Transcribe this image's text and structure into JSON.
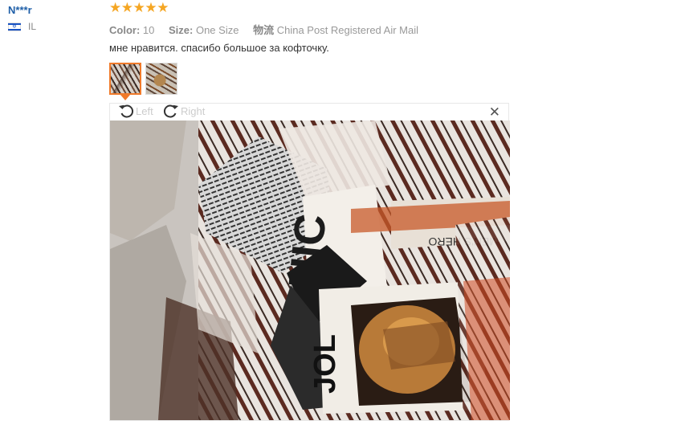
{
  "reviewer": {
    "name": "N***r",
    "country": "IL",
    "flag_icon": "israel-flag-icon"
  },
  "rating": {
    "stars": 5,
    "max": 5,
    "color": "#f5a623"
  },
  "attributes": [
    {
      "label": "Color:",
      "value": "10"
    },
    {
      "label": "Size:",
      "value": "One Size"
    },
    {
      "label": "物流",
      "value": "China Post Registered Air Mail"
    }
  ],
  "review_text": "мне нравится. спасибо большое за кофточку.",
  "thumbnails": [
    {
      "name": "photo-1",
      "active": true
    },
    {
      "name": "photo-2",
      "active": false
    }
  ],
  "viewer": {
    "rotate_left_label": "Left",
    "rotate_right_label": "Right",
    "close_icon": "close-icon",
    "photo_texts": [
      "CHIC",
      "MEN'S HERO",
      "JOL"
    ]
  },
  "colors": {
    "accent": "#f07a2a",
    "username": "#1f5fa8"
  }
}
